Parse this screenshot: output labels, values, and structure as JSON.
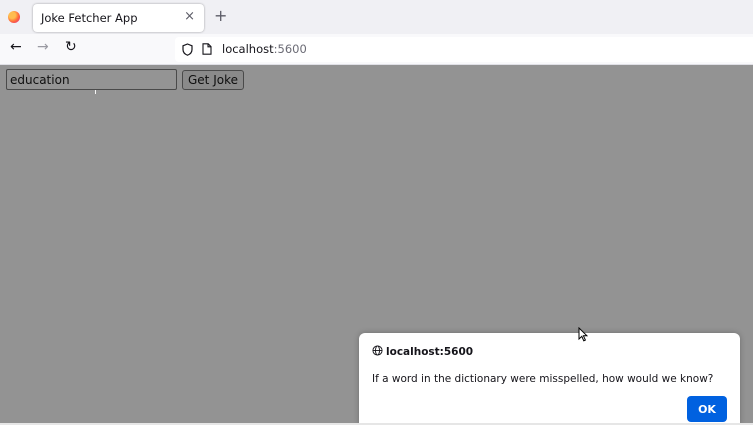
{
  "browser": {
    "tab": {
      "title": "Joke Fetcher App",
      "close_glyph": "×"
    },
    "new_tab_glyph": "+",
    "nav": {
      "back_glyph": "←",
      "forward_glyph": "→",
      "reload_glyph": "↻"
    },
    "url": {
      "host": "localhost",
      "port": ":5600"
    }
  },
  "page": {
    "topic_input_value": "education",
    "get_joke_label": "Get Joke"
  },
  "dialog": {
    "origin": "localhost:5600",
    "message": "If a word in the dictionary were misspelled, how would we know?",
    "ok_label": "OK"
  },
  "colors": {
    "overlay": "#939393",
    "primary_button": "#0061e0"
  }
}
